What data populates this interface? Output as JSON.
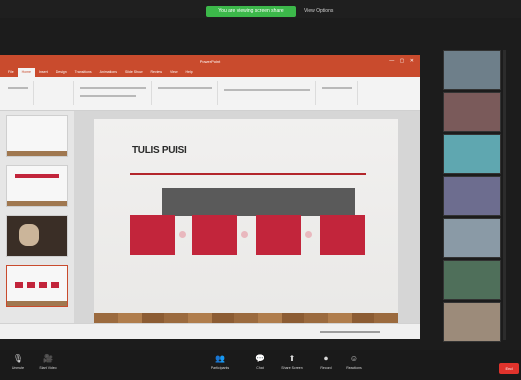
{
  "zoom": {
    "share_banner": "You are viewing screen share",
    "view_options": "View Options",
    "toolbar": [
      {
        "label": "Unmute",
        "icon": "microphone-icon"
      },
      {
        "label": "Start Video",
        "icon": "video-camera-icon"
      },
      {
        "label": "Participants",
        "icon": "participants-icon"
      },
      {
        "label": "Chat",
        "icon": "chat-icon"
      },
      {
        "label": "Share Screen",
        "icon": "share-screen-icon"
      },
      {
        "label": "Record",
        "icon": "record-icon"
      },
      {
        "label": "Reactions",
        "icon": "reactions-icon"
      }
    ],
    "end_label": "End"
  },
  "powerpoint": {
    "title": "PowerPoint",
    "tabs": [
      "File",
      "Home",
      "Insert",
      "Design",
      "Transitions",
      "Animations",
      "Slide Show",
      "Review",
      "View",
      "Help"
    ],
    "active_tab_index": 1,
    "slide": {
      "title": "TULIS PUISI",
      "banner": "",
      "boxes": [
        "",
        "",
        "",
        ""
      ]
    }
  },
  "participants": [
    {
      "name": "",
      "bg": "#6e7f8a"
    },
    {
      "name": "",
      "bg": "#7a5a5a"
    },
    {
      "name": "",
      "bg": "#5fa7b0"
    },
    {
      "name": "",
      "bg": "#6d6d8f"
    },
    {
      "name": "",
      "bg": "#8a9aa6"
    },
    {
      "name": "",
      "bg": "#4f6f5a"
    },
    {
      "name": "",
      "bg": "#9c8b7a"
    }
  ]
}
